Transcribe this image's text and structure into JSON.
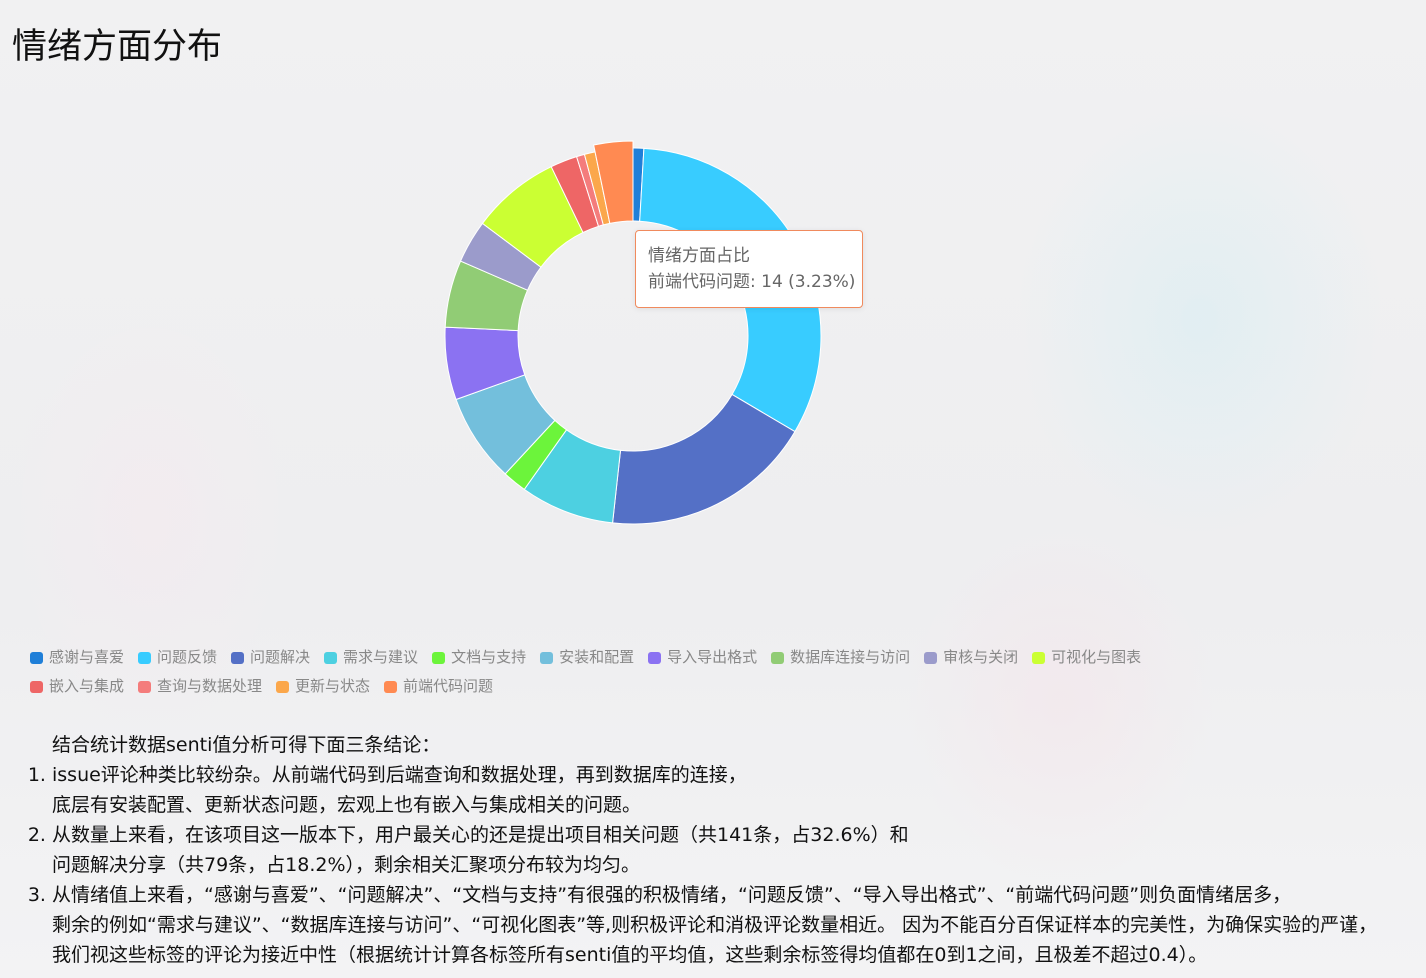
{
  "page": {
    "title": "情绪方面分布"
  },
  "chart_data": {
    "type": "pie",
    "variant": "donut",
    "total": 433,
    "series": [
      {
        "name": "情绪方面占比",
        "data": [
          {
            "name": "感谢与喜爱",
            "value": 4,
            "color": "#1f7fd8"
          },
          {
            "name": "问题反馈",
            "value": 141,
            "color": "#38ccff"
          },
          {
            "name": "问题解决",
            "value": 79,
            "color": "#5470c6"
          },
          {
            "name": "需求与建议",
            "value": 35,
            "color": "#4dd0e1"
          },
          {
            "name": "文档与支持",
            "value": 9,
            "color": "#6cf43b"
          },
          {
            "name": "安装和配置",
            "value": 33,
            "color": "#73bfdc"
          },
          {
            "name": "导入导出格式",
            "value": 27,
            "color": "#8b72f2"
          },
          {
            "name": "数据库连接与访问",
            "value": 25,
            "color": "#91cc75"
          },
          {
            "name": "审核与关闭",
            "value": 16,
            "color": "#9b9bcb"
          },
          {
            "name": "可视化与图表",
            "value": 33,
            "color": "#cbff33"
          },
          {
            "name": "嵌入与集成",
            "value": 10,
            "color": "#ee6666"
          },
          {
            "name": "查询与数据处理",
            "value": 3,
            "color": "#f47c7c"
          },
          {
            "name": "更新与状态",
            "value": 4,
            "color": "#fba74b"
          },
          {
            "name": "前端代码问题",
            "value": 14,
            "color": "#ff8a52"
          }
        ]
      }
    ],
    "highlighted": "前端代码问题",
    "legend_position": "bottom-left"
  },
  "tooltip": {
    "title": "情绪方面占比",
    "label": "前端代码问题: 14 (3.23%)"
  },
  "analysis": {
    "intro": "结合统计数据senti值分析可得下面三条结论：",
    "points": [
      {
        "line1": "issue评论种类比较纷杂。从前端代码到后端查询和数据处理，再到数据库的连接，",
        "line2": "底层有安装配置、更新状态问题，宏观上也有嵌入与集成相关的问题。"
      },
      {
        "line1": "从数量上来看，在该项目这一版本下，用户最关心的还是提出项目相关问题（共141条，占32.6%）和",
        "line2": "问题解决分享（共79条，占18.2%），剩余相关汇聚项分布较为均匀。"
      },
      {
        "line1": "从情绪值上来看，“感谢与喜爱”、“问题解决”、“文档与支持”有很强的积极情绪，“问题反馈”、“导入导出格式”、“前端代码问题”则负面情绪居多，",
        "line2": "剩余的例如“需求与建议”、“数据库连接与访问”、“可视化图表”等,则积极评论和消极评论数量相近。 因为不能百分百保证样本的完美性，为确保实验的严谨，",
        "line3": "我们视这些标签的评论为接近中性（根据统计计算各标签所有senti值的平均值，这些剩余标签得均值都在0到1之间，且极差不超过0.4）。"
      }
    ]
  }
}
